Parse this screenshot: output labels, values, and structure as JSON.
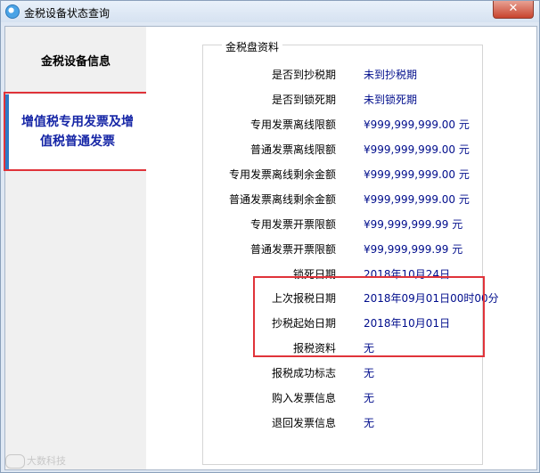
{
  "window": {
    "title": "金税设备状态查询",
    "close_label": "✕"
  },
  "sidebar": {
    "items": [
      {
        "label": "金税设备信息",
        "selected": false
      },
      {
        "label_line1": "增值税专用发票及增",
        "label_line2": "值税普通发票",
        "selected": true
      }
    ]
  },
  "panel": {
    "group_title": "金税盘资料",
    "rows": [
      {
        "label": "是否到抄税期",
        "value": "未到抄税期"
      },
      {
        "label": "是否到锁死期",
        "value": "未到锁死期"
      },
      {
        "label": "专用发票离线限额",
        "value": "¥999,999,999.00 元"
      },
      {
        "label": "普通发票离线限额",
        "value": "¥999,999,999.00 元"
      },
      {
        "label": "专用发票离线剩余金额",
        "value": "¥999,999,999.00 元"
      },
      {
        "label": "普通发票离线剩余金额",
        "value": "¥999,999,999.00 元"
      },
      {
        "label": "专用发票开票限额",
        "value": "¥99,999,999.99 元"
      },
      {
        "label": "普通发票开票限额",
        "value": "¥99,999,999.99 元"
      },
      {
        "label": "锁死日期",
        "value": "2018年10月24日"
      },
      {
        "label": "上次报税日期",
        "value": "2018年09月01日00时00分"
      },
      {
        "label": "抄税起始日期",
        "value": "2018年10月01日"
      },
      {
        "label": "报税资料",
        "value": "无"
      },
      {
        "label": "报税成功标志",
        "value": "无"
      },
      {
        "label": "购入发票信息",
        "value": "无"
      },
      {
        "label": "退回发票信息",
        "value": "无"
      }
    ]
  },
  "watermark": {
    "text": "大数科技"
  },
  "colors": {
    "value_text": "#000d8c",
    "selected_nav_text": "#1626a6",
    "highlight": "#e0333a",
    "accent_bar": "#2d79c5"
  },
  "icons": {
    "app": "app-globe-icon",
    "close": "close-icon"
  }
}
